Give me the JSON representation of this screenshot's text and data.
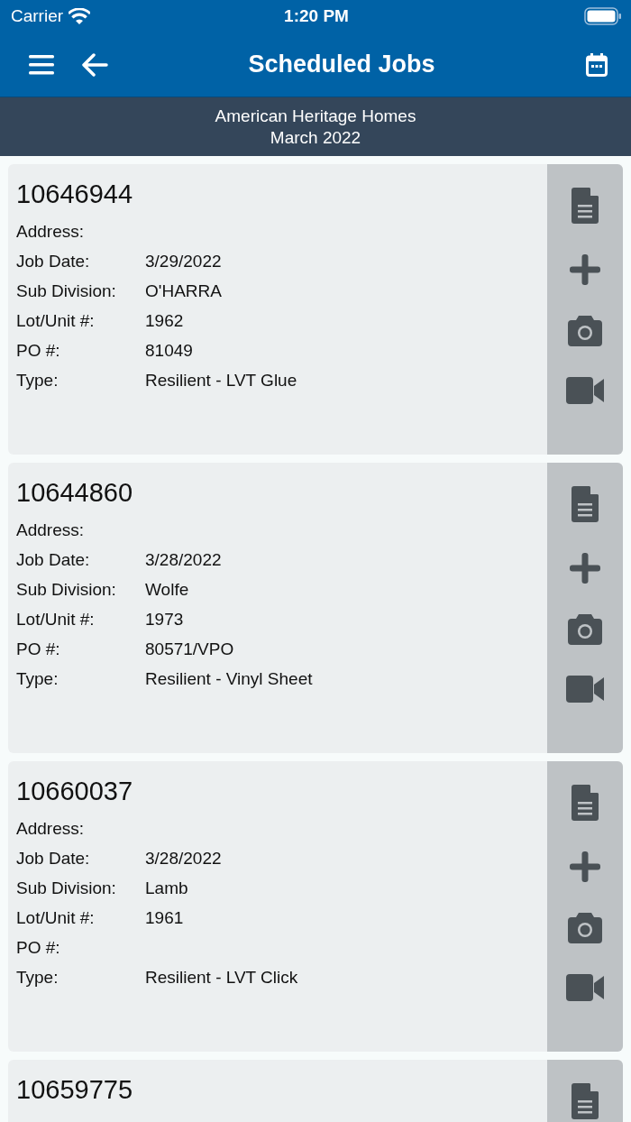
{
  "status_bar": {
    "carrier": "Carrier",
    "time": "1:20 PM"
  },
  "nav": {
    "title": "Scheduled Jobs"
  },
  "subheader": {
    "company": "American Heritage Homes",
    "period": "March 2022"
  },
  "jobs": [
    {
      "number": "10646944",
      "fields": [
        {
          "label": "Address:"
        },
        {
          "label": "Job Date:",
          "value": "3/29/2022"
        },
        {
          "label": "Sub Division:",
          "value": "O'HARRA"
        },
        {
          "label": "Lot/Unit #:",
          "value": "1962"
        },
        {
          "label": "PO #:",
          "value": "81049"
        },
        {
          "label": "Type:",
          "value": "Resilient - LVT Glue"
        }
      ],
      "actions": [
        {
          "kind": "document"
        },
        {
          "kind": "add"
        },
        {
          "kind": "camera"
        },
        {
          "kind": "video"
        }
      ]
    },
    {
      "number": "10644860",
      "fields": [
        {
          "label": "Address:"
        },
        {
          "label": "Job Date:",
          "value": "3/28/2022"
        },
        {
          "label": "Sub Division:",
          "value": "Wolfe"
        },
        {
          "label": "Lot/Unit #:",
          "value": "1973"
        },
        {
          "label": "PO #:",
          "value": "80571/VPO"
        },
        {
          "label": "Type:",
          "value": "Resilient - Vinyl Sheet"
        }
      ],
      "actions": [
        {
          "kind": "document"
        },
        {
          "kind": "add"
        },
        {
          "kind": "camera"
        },
        {
          "kind": "video"
        }
      ]
    },
    {
      "number": "10660037",
      "fields": [
        {
          "label": "Address:"
        },
        {
          "label": "Job Date:",
          "value": "3/28/2022"
        },
        {
          "label": "Sub Division:",
          "value": "Lamb"
        },
        {
          "label": "Lot/Unit #:",
          "value": "1961"
        },
        {
          "label": "PO #:"
        },
        {
          "label": "Type:",
          "value": "Resilient - LVT Click"
        }
      ],
      "actions": [
        {
          "kind": "document"
        },
        {
          "kind": "add"
        },
        {
          "kind": "camera"
        },
        {
          "kind": "video"
        }
      ]
    },
    {
      "number": "10659775",
      "actions": [
        {
          "kind": "document"
        }
      ]
    }
  ]
}
